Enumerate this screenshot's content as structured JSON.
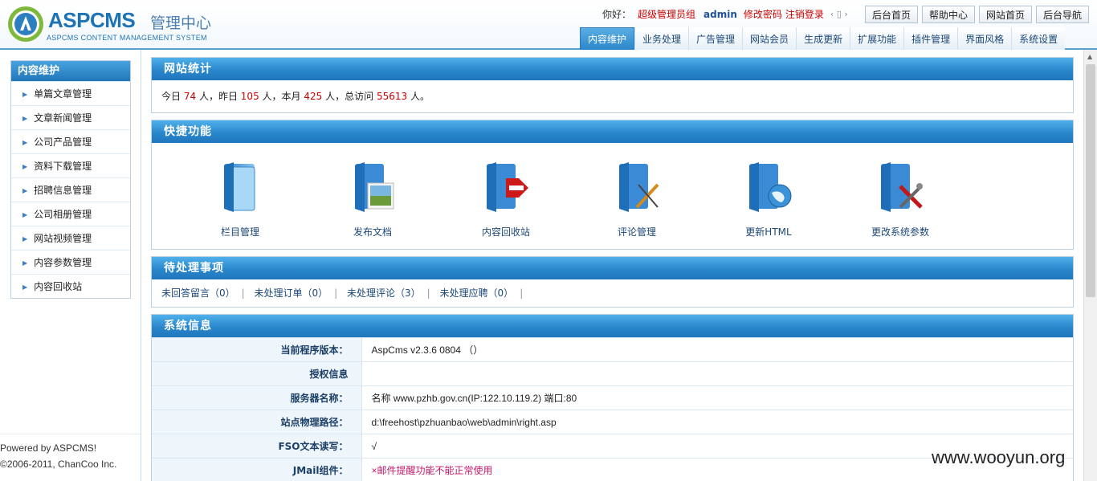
{
  "header": {
    "logo_text": "ASPCMS",
    "logo_cn": "管理中心",
    "logo_sub": "ASPCMS CONTENT MANAGEMENT SYSTEM",
    "greeting": "你好：",
    "user_group": "超级管理员组",
    "username": "admin",
    "change_password": "修改密码",
    "logout": "注销登录",
    "buttons": [
      "后台首页",
      "帮助中心",
      "网站首页",
      "后台导航"
    ],
    "tabs": [
      "内容维护",
      "业务处理",
      "广告管理",
      "网站会员",
      "生成更新",
      "扩展功能",
      "插件管理",
      "界面风格",
      "系统设置"
    ]
  },
  "sidebar": {
    "title": "内容维护",
    "items": [
      "单篇文章管理",
      "文章新闻管理",
      "公司产品管理",
      "资料下载管理",
      "招聘信息管理",
      "公司相册管理",
      "网站视频管理",
      "内容参数管理",
      "内容回收站"
    ],
    "powered_line1": "Powered by ASPCMS!",
    "powered_line2": "©2006-2011, ChanCoo Inc."
  },
  "stats": {
    "title": "网站统计",
    "t1": "今日",
    "today": "74",
    "t2": "人，昨日",
    "yesterday": "105",
    "t3": "人，本月",
    "month": "425",
    "t4": "人，总访问",
    "total": "55613",
    "t5": "人。"
  },
  "quick": {
    "title": "快捷功能",
    "items": [
      "栏目管理",
      "发布文档",
      "内容回收站",
      "评论管理",
      "更新HTML",
      "更改系统参数"
    ]
  },
  "todo": {
    "title": "待处理事项",
    "items": [
      "未回答留言（0）",
      "未处理订单（0）",
      "未处理评论（3）",
      "未处理应聘（0）"
    ]
  },
  "system": {
    "title": "系统信息",
    "rows": [
      {
        "key": "当前程序版本：",
        "value": "AspCms v2.3.6 0804 （）"
      },
      {
        "key": "授权信息",
        "value": ""
      },
      {
        "key": "服务器名称：",
        "value": "名称 www.pzhb.gov.cn(IP:122.10.119.2) 端口:80"
      },
      {
        "key": "站点物理路径：",
        "value": "d:\\freehost\\pzhuanbao\\web\\admin\\right.asp"
      },
      {
        "key": "FSO文本读写：",
        "value": "√"
      },
      {
        "key": "JMail组件：",
        "value": "×邮件提醒功能不能正常使用"
      }
    ]
  },
  "watermark": "www.wooyun.org"
}
